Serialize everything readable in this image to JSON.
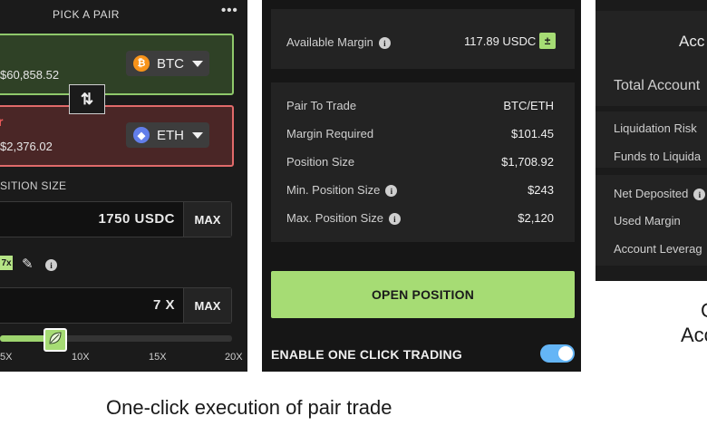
{
  "pair_panel": {
    "title": "PICK A PAIR",
    "menu_glyph": "•••",
    "long_card": {
      "price": "$60,858.52",
      "token": "BTC",
      "coin_glyph": "₿"
    },
    "short_card": {
      "label_fragment": "r",
      "price": "$2,376.02",
      "token": "ETH",
      "coin_glyph": "◆"
    },
    "swap_glyph": "⇅",
    "position_size_label": "SITION SIZE",
    "size_input": {
      "value": "1750 USDC",
      "max_label": "MAX"
    },
    "leverage_chip": "7x",
    "edit_glyph": "✎",
    "info_glyph": "i",
    "leverage_input": {
      "value": "7 X",
      "max_label": "MAX"
    },
    "slider": {
      "value_fraction": 0.24,
      "ticks": [
        "5X",
        "10X",
        "15X",
        "20X"
      ]
    },
    "colors": {
      "long_accent": "#8fc86b",
      "short_accent": "#e06a6a",
      "accent_green": "#a6dc74"
    }
  },
  "summary_panel": {
    "available_margin": {
      "label": "Available Margin",
      "value": "117.89 USDC",
      "calc_glyph": "±"
    },
    "rows": [
      {
        "label": "Pair To Trade",
        "value": "BTC/ETH",
        "info": false
      },
      {
        "label": "Margin Required",
        "value": "$101.45",
        "info": false
      },
      {
        "label": "Position Size",
        "value": "$1,708.92",
        "info": false
      },
      {
        "label": "Min. Position Size",
        "value": "$243",
        "info": true
      },
      {
        "label": "Max. Position Size",
        "value": "$2,120",
        "info": true
      }
    ],
    "open_button": "OPEN POSITION",
    "one_click_label": "ENABLE ONE CLICK TRADING",
    "one_click_enabled": true,
    "colors": {
      "button": "#a6dc74",
      "toggle": "#64b5f6"
    }
  },
  "account_panel": {
    "title": "Acc",
    "total_label": "Total Account",
    "risk_rows": [
      "Liquidation Risk",
      "Funds to Liquida"
    ],
    "stat_rows": [
      "Net Deposited",
      "Used Margin",
      "Account Leverag"
    ]
  },
  "captions": {
    "main": "One-click execution of pair trade",
    "right_line1": "C",
    "right_line2": "Acc"
  }
}
